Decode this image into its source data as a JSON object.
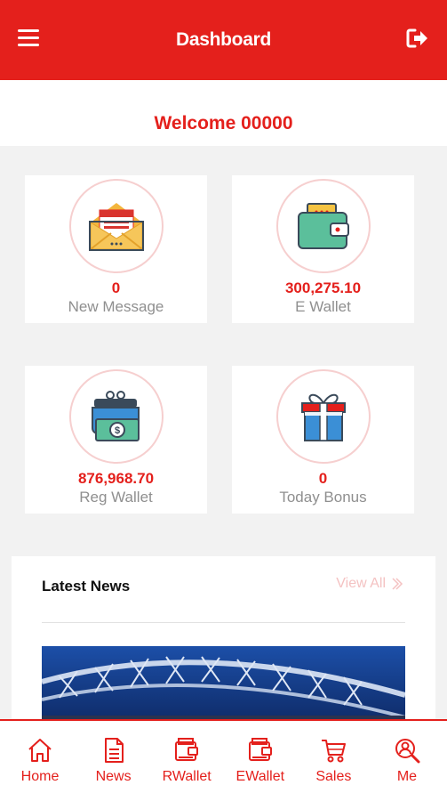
{
  "header": {
    "title": "Dashboard",
    "menu_icon": "hamburger-menu-icon",
    "logout_icon": "logout-icon"
  },
  "welcome": {
    "text": "Welcome 00000"
  },
  "cards": [
    {
      "value": "0",
      "label": "New Message",
      "icon": "envelope-icon"
    },
    {
      "value": "300,275.10",
      "label": "E Wallet",
      "icon": "wallet-icon"
    },
    {
      "value": "876,968.70",
      "label": "Reg Wallet",
      "icon": "purse-money-icon"
    },
    {
      "value": "0",
      "label": "Today Bonus",
      "icon": "gift-icon"
    }
  ],
  "news": {
    "title": "Latest News",
    "view_all": "View All",
    "image": "bridge-night-photo"
  },
  "tabs": [
    {
      "label": "Home",
      "icon": "home-icon"
    },
    {
      "label": "News",
      "icon": "document-icon"
    },
    {
      "label": "RWallet",
      "icon": "wallet-icon"
    },
    {
      "label": "EWallet",
      "icon": "wallet-icon"
    },
    {
      "label": "Sales",
      "icon": "cart-icon"
    },
    {
      "label": "Me",
      "icon": "user-search-icon"
    }
  ],
  "colors": {
    "brand_red": "#e4201c",
    "light_red": "#f6cfcf",
    "muted_text": "#8f8f8f",
    "background": "#f2f2f2"
  }
}
